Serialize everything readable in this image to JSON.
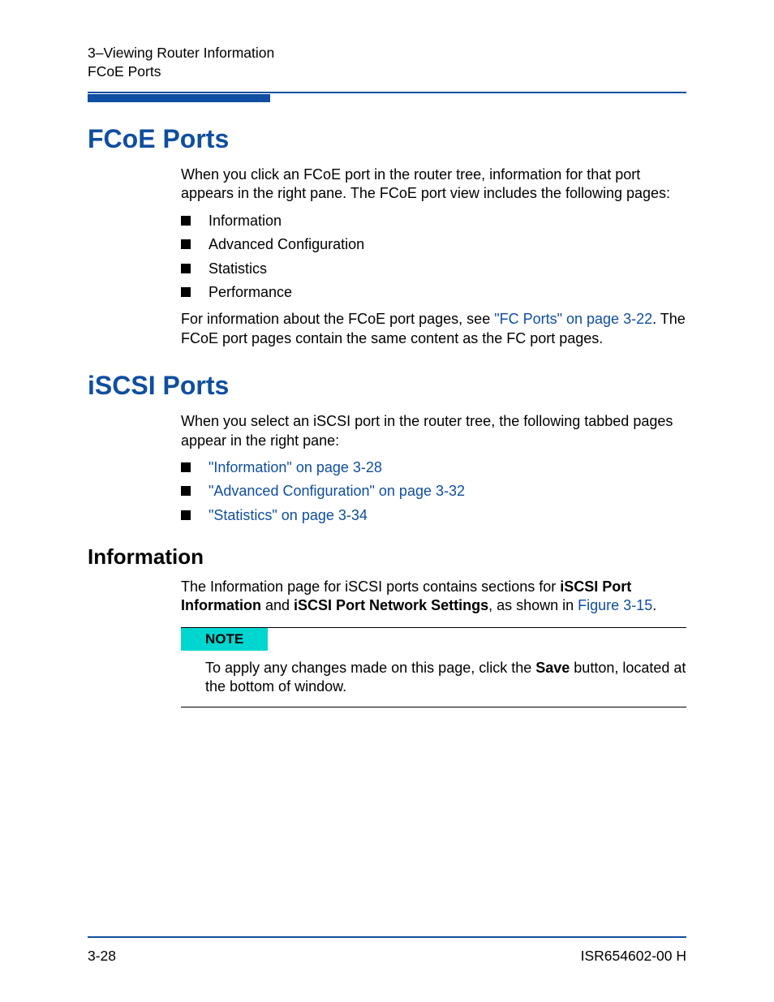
{
  "header": {
    "chapter": "3–Viewing Router Information",
    "section": "FCoE Ports"
  },
  "fcoe": {
    "heading": "FCoE Ports",
    "intro": "When you click an FCoE port in the router tree, information for that port appears in the right pane. The FCoE port view includes the following pages:",
    "items": [
      "Information",
      "Advanced Configuration",
      "Statistics",
      "Performance"
    ],
    "after_pre": "For information about the FCoE port pages, see ",
    "after_link": "\"FC Ports\" on page 3-22",
    "after_post": ". The FCoE port pages contain the same content as the FC port pages."
  },
  "iscsi": {
    "heading": "iSCSI Ports",
    "intro": "When you select an iSCSI port in the router tree, the following tabbed pages appear in the right pane:",
    "links": [
      "\"Information\" on page 3-28",
      "\"Advanced Configuration\" on page 3-32",
      "\"Statistics\" on page 3-34"
    ]
  },
  "info": {
    "heading": "Information",
    "p1_pre": "The Information page for iSCSI ports contains sections for ",
    "p1_b1": "iSCSI Port Information",
    "p1_mid": " and ",
    "p1_b2": "iSCSI Port Network Settings",
    "p1_post": ", as shown in ",
    "p1_link": "Figure 3-15",
    "p1_end": "."
  },
  "note": {
    "label": "NOTE",
    "text_pre": "To apply any changes made on this page, click the ",
    "text_bold": "Save",
    "text_post": " button, located at the bottom of window."
  },
  "footer": {
    "page": "3-28",
    "docid": "ISR654602-00  H"
  }
}
